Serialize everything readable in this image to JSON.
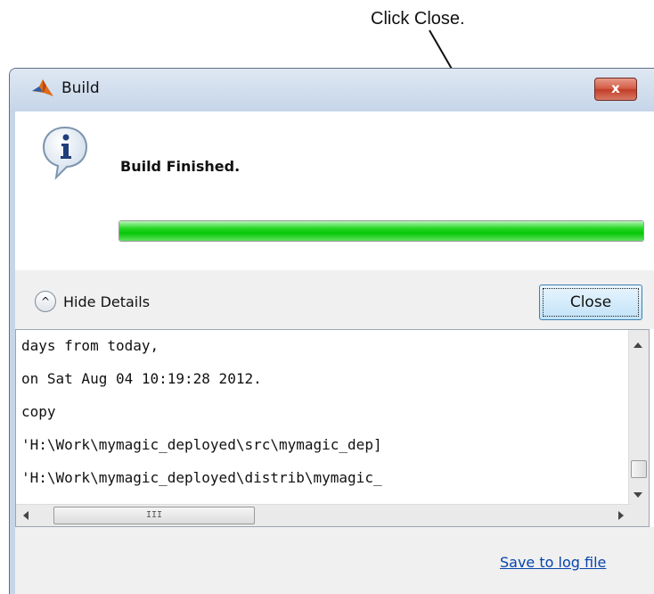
{
  "annotation": {
    "text": "Click Close."
  },
  "window": {
    "title": "Build",
    "app_icon": "matlab-logo-icon",
    "close_glyph": "x",
    "close_color": "#c8432d"
  },
  "message": {
    "icon": "info-icon",
    "text": "Build Finished.",
    "progress": 1.0,
    "progress_color": "#0ac80a"
  },
  "details": {
    "toggle_icon": "chevron-up-icon",
    "toggle_glyph": "^",
    "toggle_label": "Hide Details",
    "close_label": "Close"
  },
  "log": {
    "lines": [
      "days from today,",
      "on Sat Aug 04 10:19:28 2012.",
      "copy",
      "'H:\\Work\\mymagic_deployed\\src\\mymagic_dep]",
      "'H:\\Work\\mymagic_deployed\\distrib\\mymagic_"
    ],
    "hscroll_thumb_label": "III"
  },
  "footer": {
    "save_link": "Save to log file",
    "link_color": "#0645ad"
  }
}
